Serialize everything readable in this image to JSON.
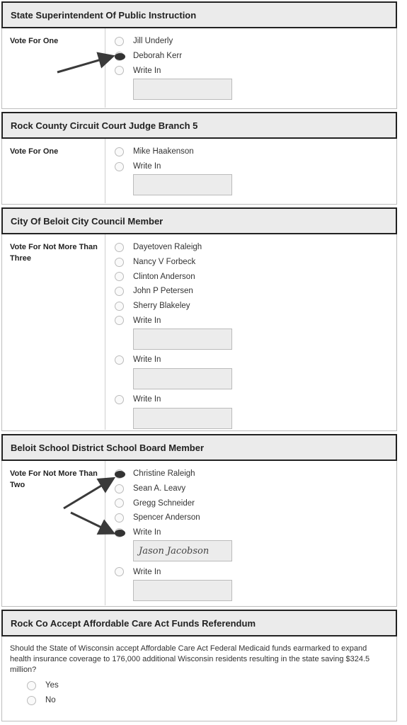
{
  "races": [
    {
      "title": "State Superintendent Of Public Instruction",
      "instruction": "Vote For One",
      "options": [
        {
          "label": "Jill Underly",
          "selected": false
        },
        {
          "label": "Deborah Kerr",
          "selected": true
        },
        {
          "label": "Write In",
          "selected": false,
          "writein": true,
          "writein_value": ""
        }
      ]
    },
    {
      "title": "Rock County Circuit Court Judge Branch 5",
      "instruction": "Vote For One",
      "options": [
        {
          "label": "Mike Haakenson",
          "selected": false
        },
        {
          "label": "Write In",
          "selected": false,
          "writein": true,
          "writein_value": ""
        }
      ]
    },
    {
      "title": "City Of Beloit City Council Member",
      "instruction": "Vote For Not More Than Three",
      "options": [
        {
          "label": "Dayetoven Raleigh",
          "selected": false
        },
        {
          "label": "Nancy V Forbeck",
          "selected": false
        },
        {
          "label": "Clinton Anderson",
          "selected": false
        },
        {
          "label": "John P Petersen",
          "selected": false
        },
        {
          "label": "Sherry Blakeley",
          "selected": false
        },
        {
          "label": "Write In",
          "selected": false,
          "writein": true,
          "writein_value": ""
        },
        {
          "label": "Write In",
          "selected": false,
          "writein": true,
          "writein_value": ""
        },
        {
          "label": "Write In",
          "selected": false,
          "writein": true,
          "writein_value": ""
        }
      ]
    },
    {
      "title": "Beloit School District School Board Member",
      "instruction": "Vote For Not More Than Two",
      "options": [
        {
          "label": "Christine Raleigh",
          "selected": true
        },
        {
          "label": "Sean A. Leavy",
          "selected": false
        },
        {
          "label": "Gregg Schneider",
          "selected": false
        },
        {
          "label": "Spencer Anderson",
          "selected": false
        },
        {
          "label": "Write In",
          "selected": true,
          "writein": true,
          "writein_value": "Jason Jacobson"
        },
        {
          "label": "Write In",
          "selected": false,
          "writein": true,
          "writein_value": ""
        }
      ]
    }
  ],
  "referendum": {
    "title": "Rock Co Accept Affordable Care Act Funds Referendum",
    "question": "Should the State of Wisconsin accept Affordable Care Act Federal Medicaid funds earmarked to expand health insurance coverage to 176,000 additional Wisconsin residents resulting in the state saving $324.5 million?",
    "options": [
      {
        "label": "Yes",
        "selected": false
      },
      {
        "label": "No",
        "selected": false
      }
    ]
  }
}
